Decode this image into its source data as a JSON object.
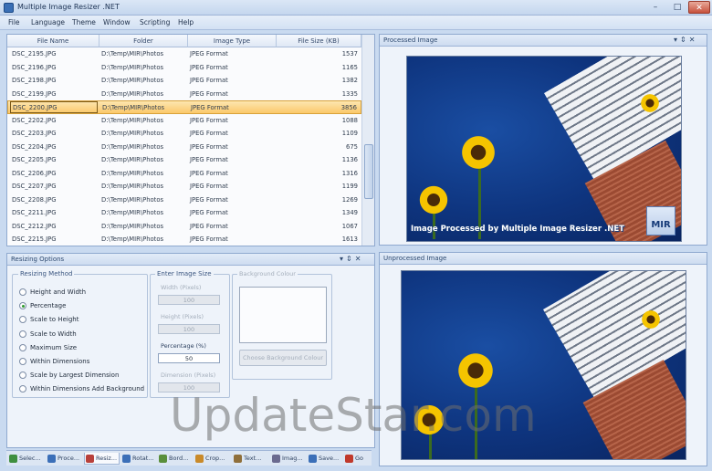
{
  "window": {
    "title": "Multiple Image Resizer .NET",
    "controls": {
      "minimize": "–",
      "maximize": "□",
      "close": "✕"
    }
  },
  "menu": [
    "File",
    "Language",
    "Theme",
    "Window",
    "Scripting",
    "Help"
  ],
  "file_list": {
    "columns": [
      "File Name",
      "Folder",
      "Image Type",
      "File Size (KB)"
    ],
    "rows": [
      {
        "name": "DSC_2195.JPG",
        "folder": "D:\\Temp\\MIR\\Photos",
        "type": "JPEG Format",
        "size": "1537"
      },
      {
        "name": "DSC_2196.JPG",
        "folder": "D:\\Temp\\MIR\\Photos",
        "type": "JPEG Format",
        "size": "1165"
      },
      {
        "name": "DSC_2198.JPG",
        "folder": "D:\\Temp\\MIR\\Photos",
        "type": "JPEG Format",
        "size": "1382"
      },
      {
        "name": "DSC_2199.JPG",
        "folder": "D:\\Temp\\MIR\\Photos",
        "type": "JPEG Format",
        "size": "1335"
      },
      {
        "name": "DSC_2200.JPG",
        "folder": "D:\\Temp\\MIR\\Photos",
        "type": "JPEG Format",
        "size": "3856"
      },
      {
        "name": "DSC_2202.JPG",
        "folder": "D:\\Temp\\MIR\\Photos",
        "type": "JPEG Format",
        "size": "1088"
      },
      {
        "name": "DSC_2203.JPG",
        "folder": "D:\\Temp\\MIR\\Photos",
        "type": "JPEG Format",
        "size": "1109"
      },
      {
        "name": "DSC_2204.JPG",
        "folder": "D:\\Temp\\MIR\\Photos",
        "type": "JPEG Format",
        "size": "675"
      },
      {
        "name": "DSC_2205.JPG",
        "folder": "D:\\Temp\\MIR\\Photos",
        "type": "JPEG Format",
        "size": "1136"
      },
      {
        "name": "DSC_2206.JPG",
        "folder": "D:\\Temp\\MIR\\Photos",
        "type": "JPEG Format",
        "size": "1316"
      },
      {
        "name": "DSC_2207.JPG",
        "folder": "D:\\Temp\\MIR\\Photos",
        "type": "JPEG Format",
        "size": "1199"
      },
      {
        "name": "DSC_2208.JPG",
        "folder": "D:\\Temp\\MIR\\Photos",
        "type": "JPEG Format",
        "size": "1269"
      },
      {
        "name": "DSC_2211.JPG",
        "folder": "D:\\Temp\\MIR\\Photos",
        "type": "JPEG Format",
        "size": "1349"
      },
      {
        "name": "DSC_2212.JPG",
        "folder": "D:\\Temp\\MIR\\Photos",
        "type": "JPEG Format",
        "size": "1067"
      },
      {
        "name": "DSC_2215.JPG",
        "folder": "D:\\Temp\\MIR\\Photos",
        "type": "JPEG Format",
        "size": "1613"
      }
    ]
  },
  "resizing_options": {
    "title": "Resizing Options",
    "method_group": "Resizing Method",
    "methods": [
      {
        "label": "Height and Width",
        "selected": false
      },
      {
        "label": "Percentage",
        "selected": true
      },
      {
        "label": "Scale to Height",
        "selected": false
      },
      {
        "label": "Scale to Width",
        "selected": false
      },
      {
        "label": "Maximum Size",
        "selected": false
      },
      {
        "label": "Within Dimensions",
        "selected": false
      },
      {
        "label": "Scale by Largest Dimension",
        "selected": false
      },
      {
        "label": "Within Dimensions Add Background",
        "selected": false
      }
    ],
    "size_group": "Enter Image Size",
    "width_label": "Width (Pixels)",
    "width_value": "100",
    "height_label": "Height (Pixels)",
    "height_value": "100",
    "percentage_label": "Percentage (%)",
    "percentage_value": "50",
    "dimension_label": "Dimension (Pixels)",
    "dimension_value": "100",
    "background_group": "Background Colour",
    "background_button": "Choose Background Colour"
  },
  "tabs": [
    {
      "label": "Selec...",
      "color": "#3f8f3f"
    },
    {
      "label": "Proce...",
      "color": "#3b6fb8"
    },
    {
      "label": "Resiz...",
      "color": "#b8403b",
      "active": true
    },
    {
      "label": "Rotat...",
      "color": "#3b6fb8"
    },
    {
      "label": "Bord...",
      "color": "#5a8f3b"
    },
    {
      "label": "Crop...",
      "color": "#c98a2a"
    },
    {
      "label": "Text...",
      "color": "#8f6f3b"
    },
    {
      "label": "Imag...",
      "color": "#6a6a8f"
    },
    {
      "label": "Save...",
      "color": "#3b6fb8"
    },
    {
      "label": "Go",
      "color": "#c0392b"
    }
  ],
  "processed_panel": {
    "title": "Processed Image",
    "watermark": "Image Processed by Multiple Image Resizer .NET",
    "logo": "MIR"
  },
  "unprocessed_panel": {
    "title": "Unprocessed Image"
  },
  "overlay_watermark": "UpdateStar.com"
}
